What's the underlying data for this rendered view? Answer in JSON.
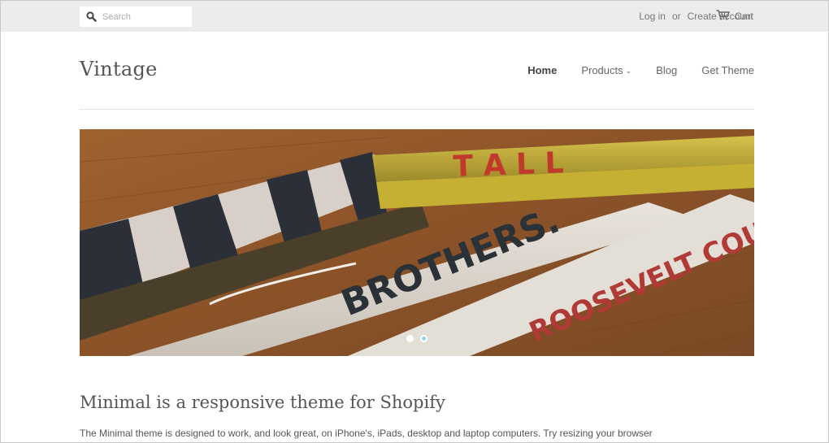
{
  "topbar": {
    "search_placeholder": "Search",
    "login_label": "Log in",
    "or_label": "or",
    "create_account_label": "Create account",
    "cart_label": "Cart"
  },
  "header": {
    "logo": "Vintage",
    "nav": [
      {
        "label": "Home",
        "active": true
      },
      {
        "label": "Products",
        "dropdown": true
      },
      {
        "label": "Blog"
      },
      {
        "label": "Get Theme"
      }
    ]
  },
  "hero": {
    "image_description": "Rolled vintage posters on a wooden table",
    "image_text": [
      "TALL",
      "BROTHERS.",
      "ROOSEVELT COUN"
    ],
    "slides_count": 2,
    "active_slide": 2
  },
  "content": {
    "heading": "Minimal is a responsive theme for Shopify",
    "paragraph": "The Minimal theme is designed to work, and look great, on iPhone's, iPads, desktop and laptop computers. Try resizing your browser"
  },
  "colors": {
    "topbar_bg": "#ececec",
    "text": "#555555",
    "dot_active": "#8fd3ec"
  }
}
